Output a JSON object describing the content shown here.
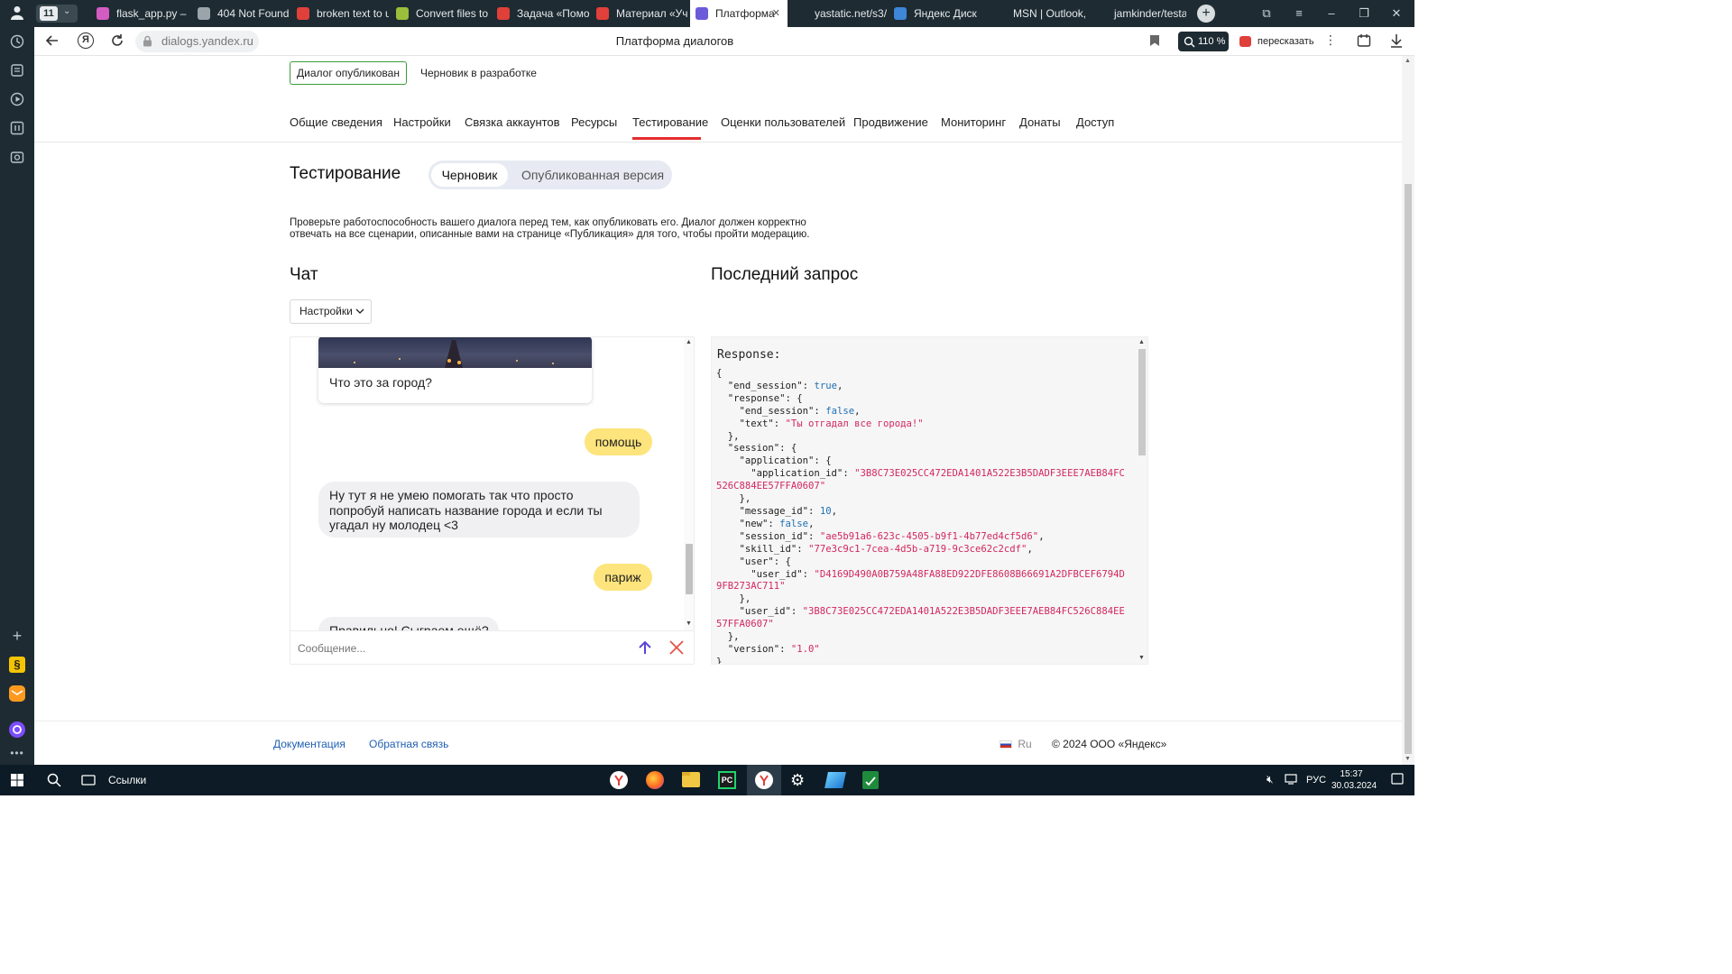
{
  "browser": {
    "tab_count": "11",
    "tabs": [
      {
        "title": "flask_app.py – r",
        "color": "#d35cc2"
      },
      {
        "title": "404 Not Found",
        "color": "#9aa4aa"
      },
      {
        "title": "broken text to u",
        "color": "#e0403a"
      },
      {
        "title": "Convert files to",
        "color": "#9bbe3b"
      },
      {
        "title": "Задача «Помо",
        "color": "#e0403a"
      },
      {
        "title": "Материал «Уче",
        "color": "#e0403a"
      },
      {
        "title": "Платформа",
        "color": "#6b5bd9"
      },
      {
        "title": "yastatic.net/s3/",
        "color": "#1e2b33"
      },
      {
        "title": "Яндекс Диск",
        "color": "#3d86d8"
      },
      {
        "title": "MSN | Outlook,",
        "color": "#1e2b33"
      },
      {
        "title": "jamkinder/testa",
        "color": "#1e2b33"
      }
    ],
    "url": "dialogs.yandex.ru",
    "page_title": "Платформа диалогов",
    "zoom": "110 %",
    "retell_label": "пересказать"
  },
  "header": {
    "published_button": "Диалог опубликован",
    "draft_link": "Черновик в разработке",
    "nav": [
      "Общие сведения",
      "Настройки",
      "Связка аккаунтов",
      "Ресурсы",
      "Тестирование",
      "Оценки пользователей",
      "Продвижение",
      "Мониторинг",
      "Донаты",
      "Доступ"
    ],
    "active_nav": "Тестирование"
  },
  "testing": {
    "title": "Тестирование",
    "toggle_draft": "Черновик",
    "toggle_published": "Опубликованная версия",
    "description_line1": "Проверьте работоспособность вашего диалога перед тем, как опубликовать его. Диалог должен корректно",
    "description_line2": "отвечать на все сценарии, описанные вами на странице «Публикация» для того, чтобы пройти модерацию."
  },
  "chat": {
    "title": "Чат",
    "settings_button": "Настройки",
    "messages": [
      {
        "from": "bot",
        "text": "Что это за город?"
      },
      {
        "from": "user",
        "text": "помощь"
      },
      {
        "from": "bot",
        "text_line1": "Ну тут я не умею помогать так что просто",
        "text_line2": "попробуй написать название города и если ты",
        "text_line3": "угадал ну молодец <3"
      },
      {
        "from": "user",
        "text": "париж"
      },
      {
        "from": "bot",
        "text": "Правильно! Сыграем ещё?"
      }
    ],
    "input_placeholder": "Сообщение..."
  },
  "last_request": {
    "title": "Последний запрос",
    "label": "Response:",
    "lines": [
      "{",
      "  \"end_session\": true,",
      "  \"response\": {",
      "    \"end_session\": false,",
      "    \"text\": \"Ты отгадал все города!\"",
      "  },",
      "  \"session\": {",
      "    \"application\": {",
      "      \"application_id\": \"3B8C73E025CC472EDA1401A522E3B5DADF3EEE7AEB84FC",
      "526C884EE57FFA0607\"",
      "    },",
      "    \"message_id\": 10,",
      "    \"new\": false,",
      "    \"session_id\": \"ae5b91a6-623c-4505-b9f1-4b77ed4cf5d6\",",
      "    \"skill_id\": \"77e3c9c1-7cea-4d5b-a719-9c3ce62c2cdf\",",
      "    \"user\": {",
      "      \"user_id\": \"D4169D490A0B759A48FA88ED922DFE8608B66691A2DFBCEF6794D",
      "9FB273AC711\"",
      "    },",
      "    \"user_id\": \"3B8C73E025CC472EDA1401A522E3B5DADF3EEE7AEB84FC526C884EE",
      "57FFA0607\"",
      "  },",
      "  \"version\": \"1.0\"",
      "}"
    ]
  },
  "footer": {
    "docs_link": "Документация",
    "feedback_link": "Обратная связь",
    "lang": "Ru",
    "copyright": "© 2024 ООО «Яндекс»"
  },
  "taskbar": {
    "search_label": "Ссылки",
    "lang": "РУС",
    "time": "15:37",
    "date": "30.03.2024"
  }
}
